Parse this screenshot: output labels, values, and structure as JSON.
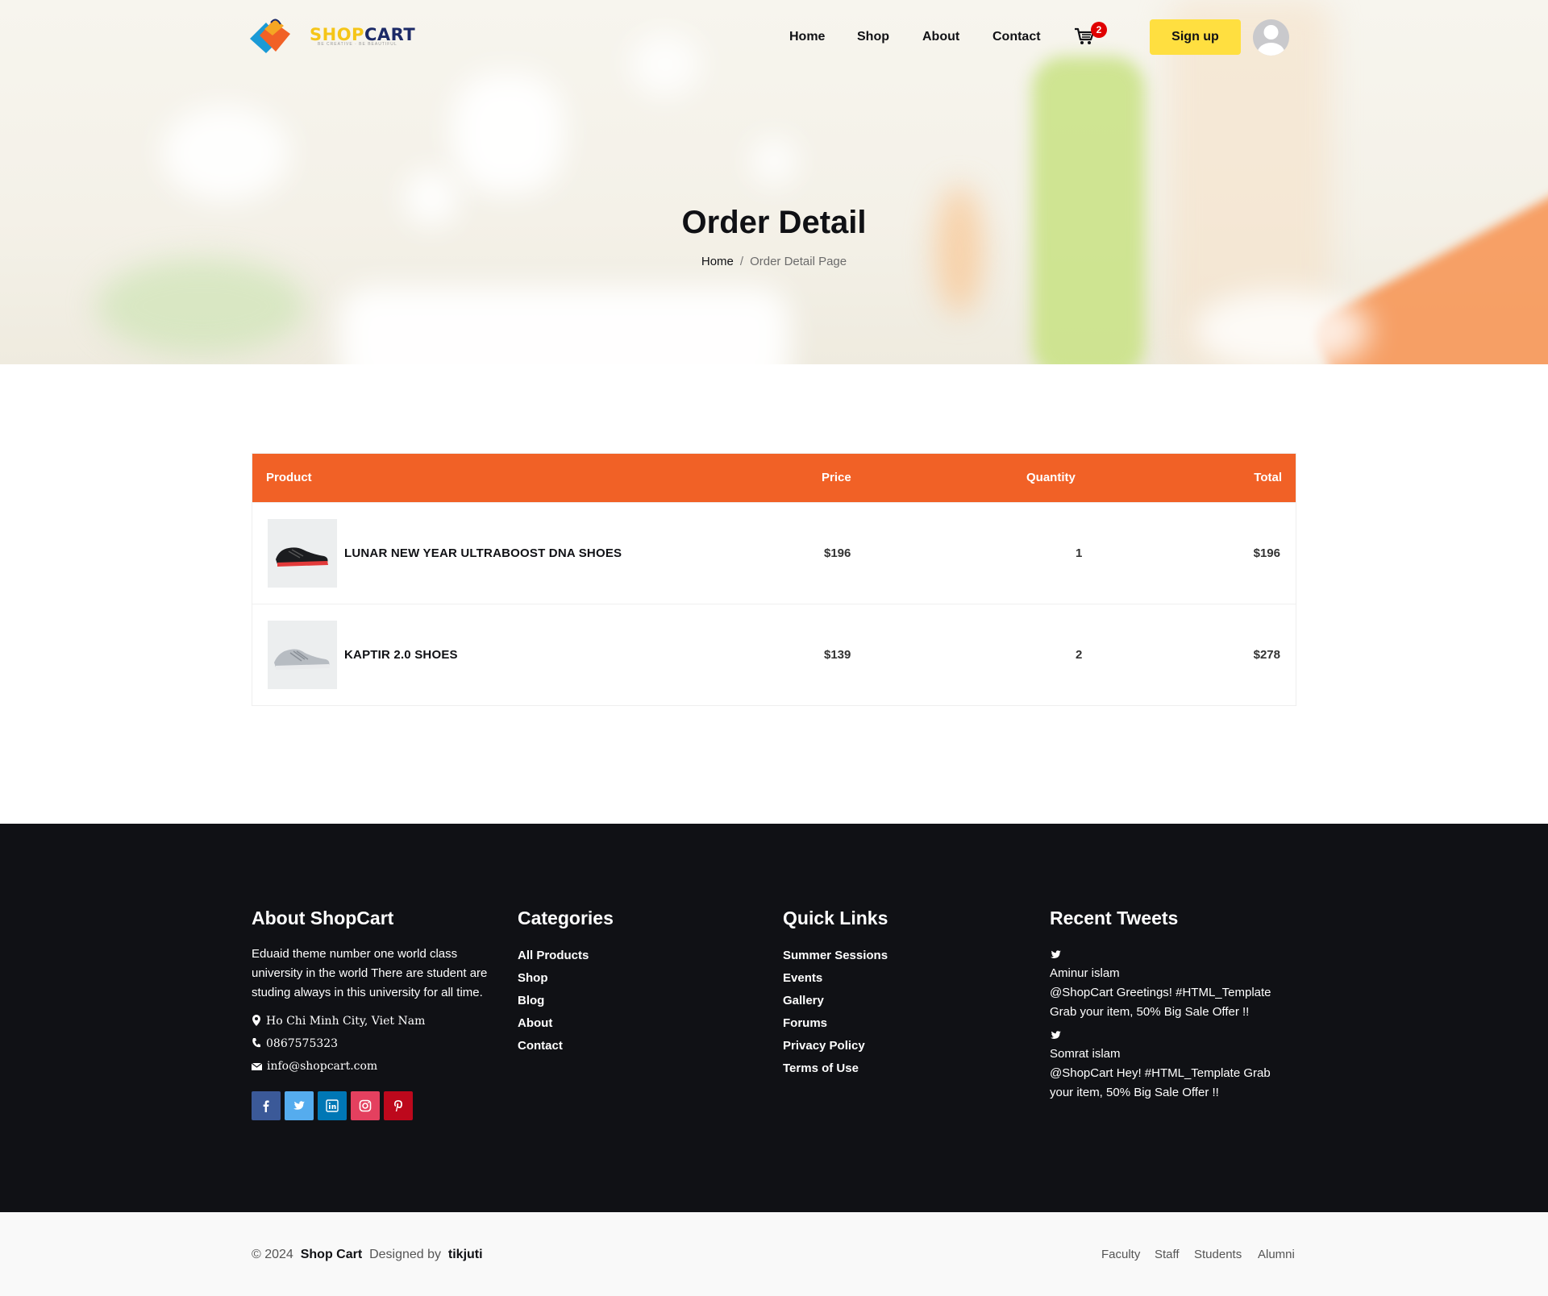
{
  "brand": {
    "logo_shop": "SHOP",
    "logo_cart": "CART",
    "tagline": "BE CREATIVE · BE BEAUTIFUL"
  },
  "nav": {
    "home": "Home",
    "shop": "Shop",
    "about": "About",
    "contact": "Contact",
    "cart_count": "2",
    "signup": "Sign up"
  },
  "hero": {
    "title": "Order Detail",
    "breadcrumb_home": "Home",
    "breadcrumb_sep": "/",
    "breadcrumb_current": "Order Detail Page"
  },
  "table": {
    "headers": {
      "product": "Product",
      "price": "Price",
      "quantity": "Quantity",
      "total": "Total"
    },
    "rows": [
      {
        "name": "LUNAR NEW YEAR ULTRABOOST DNA SHOES",
        "price": "$196",
        "quantity": "1",
        "total": "$196"
      },
      {
        "name": "KAPTIR 2.0 SHOES",
        "price": "$139",
        "quantity": "2",
        "total": "$278"
      }
    ]
  },
  "footer": {
    "about": {
      "title": "About ShopCart",
      "text": "Eduaid theme number one world class university in the world There are student are studing always in this university for all time.",
      "address": "Ho Chi Minh City, Viet Nam",
      "phone": "0867575323",
      "email": "info@shopcart.com"
    },
    "categories": {
      "title": "Categories",
      "items": [
        "All Products",
        "Shop",
        "Blog",
        "About",
        "Contact"
      ]
    },
    "quick_links": {
      "title": "Quick Links",
      "items": [
        "Summer Sessions",
        "Events",
        "Gallery",
        "Forums",
        "Privacy Policy",
        "Terms of Use"
      ]
    },
    "tweets": {
      "title": "Recent Tweets",
      "items": [
        {
          "author": "Aminur islam",
          "text": "@ShopCart Greetings! #HTML_Template Grab your item, 50% Big Sale Offer !!"
        },
        {
          "author": "Somrat islam",
          "text": "@ShopCart Hey! #HTML_Template Grab your item, 50% Big Sale Offer !!"
        }
      ]
    },
    "social_colors": {
      "facebook": "#3b5998",
      "twitter": "#55acee",
      "linkedin": "#0077b5",
      "instagram": "#e4405f",
      "pinterest": "#bd081c"
    }
  },
  "bottom": {
    "copy_prefix": "© 2024",
    "brand": "Shop Cart",
    "designed_by": "Designed by",
    "designer": "tikjuti",
    "links": [
      "Faculty",
      "Staff",
      "Students",
      "Alumni"
    ]
  },
  "colors": {
    "accent": "#f16126",
    "signup": "#ffdf40",
    "footer_bg": "#101115"
  }
}
